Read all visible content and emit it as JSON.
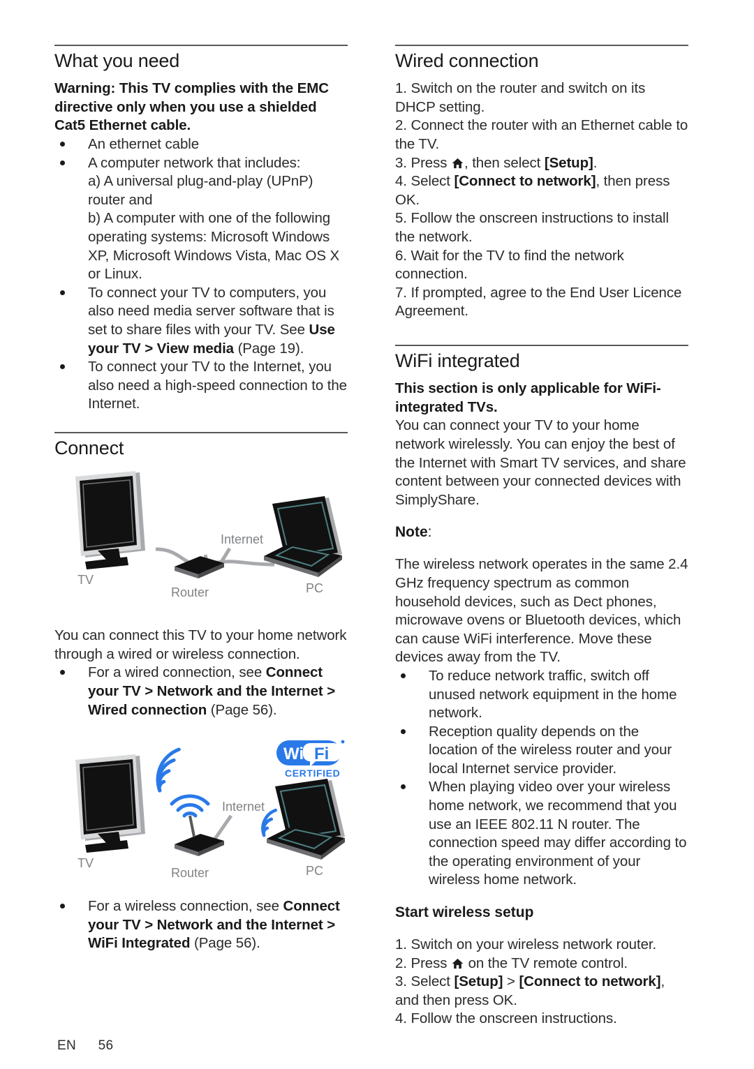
{
  "left_column": {
    "section1": {
      "title": "What you need",
      "warning": "Warning: This TV complies with the EMC directive only when you use a shielded Cat5 Ethernet cable.",
      "bullets": [
        {
          "text": "An ethernet cable"
        },
        {
          "text": "A computer network that includes:",
          "sub": [
            "a) A universal plug-and-play (UPnP) router and",
            "b) A computer with one of the following operating systems: Microsoft Windows XP, Microsoft Windows Vista, Mac OS X or Linux."
          ]
        },
        {
          "rich": [
            {
              "t": "To connect your TV to computers, you also need media server software that is set to share files with your TV. See ",
              "b": false
            },
            {
              "t": "Use your TV > View media",
              "b": true
            },
            {
              "t": " (Page 19).",
              "b": false
            }
          ]
        },
        {
          "text": "To connect your TV to the Internet, you also need a high-speed connection to the Internet."
        }
      ]
    },
    "section2": {
      "title": "Connect",
      "diagram_wired": {
        "labels": {
          "tv": "TV",
          "router": "Router",
          "internet": "Internet",
          "pc": "PC"
        }
      },
      "paragraph": "You can connect this TV to your home network through a wired or wireless connection.",
      "bullet_wired": [
        {
          "t": "For a wired connection, see ",
          "b": false
        },
        {
          "t": "Connect your TV > Network and the Internet > Wired connection",
          "b": true
        },
        {
          "t": " (Page 56).",
          "b": false
        }
      ],
      "diagram_wireless": {
        "labels": {
          "tv": "TV",
          "router": "Router",
          "internet": "Internet",
          "pc": "PC"
        },
        "logo": {
          "wi": "Wi",
          "fi": "Fi",
          "certified": "CERTIFIED",
          "color": "#2979E8"
        }
      },
      "bullet_wireless": [
        {
          "t": "For a wireless connection, see ",
          "b": false
        },
        {
          "t": "Connect your TV > Network and the Internet > WiFi Integrated",
          "b": true
        },
        {
          "t": " (Page 56).",
          "b": false
        }
      ]
    }
  },
  "right_column": {
    "section1": {
      "title": "Wired connection",
      "steps": [
        [
          {
            "t": "1. Switch on the router and switch on its DHCP setting.",
            "b": false
          }
        ],
        [
          {
            "t": "2. Connect the router with an Ethernet cable to the TV.",
            "b": false
          }
        ],
        [
          {
            "t": "3. Press ",
            "b": false
          },
          {
            "icon": "home-icon"
          },
          {
            "t": ", then select ",
            "b": false
          },
          {
            "t": "[Setup]",
            "b": true
          },
          {
            "t": ".",
            "b": false
          }
        ],
        [
          {
            "t": "4. Select ",
            "b": false
          },
          {
            "t": "[Connect to network]",
            "b": true
          },
          {
            "t": ", then press ",
            "b": false
          },
          {
            "t": "OK",
            "b": false
          },
          {
            "t": ".",
            "b": false
          }
        ],
        [
          {
            "t": "5. Follow the onscreen instructions to install the network.",
            "b": false
          }
        ],
        [
          {
            "t": "6. Wait for the TV to find the network connection.",
            "b": false
          }
        ],
        [
          {
            "t": "7. If prompted, agree to the End User Licence Agreement.",
            "b": false
          }
        ]
      ]
    },
    "section2": {
      "title": "WiFi integrated",
      "lead_bold": "This section is only applicable for WiFi-integrated TVs.",
      "paragraph": "You can connect your TV to your home network wirelessly. You can enjoy the best of the Internet with Smart TV services, and share content between your connected devices with SimplyShare.",
      "note_label": "Note",
      "note_colon": ":",
      "note_text": "The wireless network operates in the same 2.4 GHz frequency spectrum as common household devices, such as Dect phones, microwave ovens or Bluetooth devices, which can cause WiFi interference. Move these devices away from the TV.",
      "bullets": [
        "To reduce network traffic, switch off unused network equipment in the home network.",
        "Reception quality depends on the location of the wireless router and your local Internet service provider.",
        "When playing video over your wireless home network, we recommend that you use an IEEE 802.11 N router.  The connection speed may differ according to the operating environment of your wireless home network."
      ],
      "subsection": {
        "title": "Start wireless setup",
        "steps": [
          [
            {
              "t": "1. Switch on your wireless network router.",
              "b": false
            }
          ],
          [
            {
              "t": "2. Press ",
              "b": false
            },
            {
              "icon": "home-icon"
            },
            {
              "t": " on the TV remote control.",
              "b": false
            }
          ],
          [
            {
              "t": "3. Select ",
              "b": false
            },
            {
              "t": "[Setup]",
              "b": true
            },
            {
              "t": " > ",
              "b": false
            },
            {
              "t": "[Connect to network]",
              "b": true
            },
            {
              "t": ", and then press ",
              "b": false
            },
            {
              "t": "OK",
              "b": false
            },
            {
              "t": ".",
              "b": false
            }
          ],
          [
            {
              "t": "4. Follow the onscreen instructions.",
              "b": false
            }
          ]
        ]
      }
    }
  },
  "footer": {
    "language": "EN",
    "page_number": "56"
  }
}
